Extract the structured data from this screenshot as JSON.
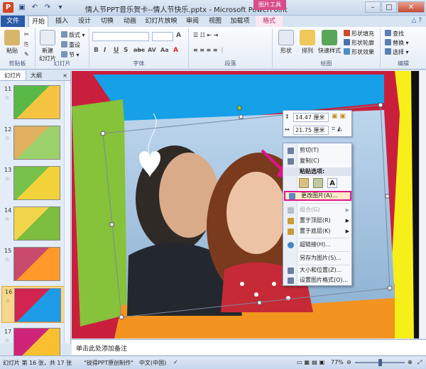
{
  "titlebar": {
    "title": "情人节PPT音乐贺卡--情人节快乐.pptx - Microsoft PowerPoint",
    "context_header": "图片工具",
    "app_letter": "P"
  },
  "tabs": [
    "文件",
    "开始",
    "插入",
    "设计",
    "切换",
    "动画",
    "幻灯片放映",
    "审阅",
    "视图",
    "加载项",
    "格式"
  ],
  "ribbon": {
    "clipboard": {
      "paste": "粘贴",
      "label": "剪贴板"
    },
    "slides": {
      "new_slide": "新建\n幻灯片",
      "layout": "版式",
      "reset": "重设",
      "section": "节",
      "label": "幻灯片"
    },
    "font": {
      "label": "字体",
      "format_glyphs": [
        "B",
        "I",
        "U",
        "S",
        "abc",
        "AV",
        "Aa",
        "A"
      ]
    },
    "paragraph": {
      "label": "段落"
    },
    "drawing": {
      "shapes": "形状",
      "arrange": "排列",
      "quick_styles": "快速样式",
      "fill": "形状填充",
      "outline": "形状轮廓",
      "effects": "形状效果",
      "label": "绘图"
    },
    "editing": {
      "find": "查找",
      "replace": "替换",
      "select": "选择",
      "label": "编辑"
    }
  },
  "left_pane": {
    "tab_slides": "幻灯片",
    "tab_outline": "大纲",
    "close": "×",
    "thumbs": [
      {
        "num": "11",
        "colors": [
          "#58b946",
          "#f5c542"
        ]
      },
      {
        "num": "12",
        "colors": [
          "#e0b060",
          "#9cd06a"
        ]
      },
      {
        "num": "13",
        "colors": [
          "#78c24c",
          "#f2d23a"
        ]
      },
      {
        "num": "14",
        "colors": [
          "#f1d54b",
          "#7cbc3e"
        ]
      },
      {
        "num": "15",
        "colors": [
          "#c84a6c",
          "#ff9a2a"
        ]
      },
      {
        "num": "16",
        "colors": [
          "#d2244e",
          "#1e9be6"
        ],
        "selected": true
      },
      {
        "num": "17",
        "colors": [
          "#d0237a",
          "#f8c030"
        ]
      }
    ]
  },
  "mini_toolbar": {
    "height_value": "14.47 厘米",
    "width_value": "21.75 厘米"
  },
  "context_menu": {
    "items": [
      {
        "label": "剪切(T)",
        "icon_color": "#6c7da0"
      },
      {
        "label": "复制(C)",
        "icon_color": "#6c7da0"
      },
      {
        "label": "更改图片(A)...",
        "icon_color": "#5a8ac0",
        "highlight": true
      },
      {
        "label": "组合(G)",
        "icon_color": "#b8bec8",
        "disabled": true,
        "submenu": true
      },
      {
        "label": "置于顶层(R)",
        "icon_color": "#c99a3a",
        "submenu": true
      },
      {
        "label": "置于底层(K)",
        "icon_color": "#c99a3a",
        "submenu": true
      },
      {
        "label": "超链接(H)...",
        "icon_color": "#3f86c8"
      },
      {
        "label": "另存为图片(S)...",
        "icon_color": "#6c7da0"
      },
      {
        "label": "大小和位置(Z)...",
        "icon_color": "#6c7da0"
      },
      {
        "label": "设置图片格式(O)...",
        "icon_color": "#6c7da0"
      }
    ],
    "paste_options": "粘贴选项:"
  },
  "notes": {
    "placeholder": "单击此处添加备注"
  },
  "status": {
    "slide_info": "幻灯片 第 16 张，共 17 张",
    "theme": "\"锐得PPT原创制作\"",
    "language": "中文(中国)",
    "zoom": "77%"
  },
  "slide": {
    "colors": {
      "red": "#c91f3c",
      "blue": "#15a0e8",
      "green": "#86c23a",
      "orange": "#f39320",
      "yellow": "#f7ef1a",
      "black": "#111111"
    }
  }
}
